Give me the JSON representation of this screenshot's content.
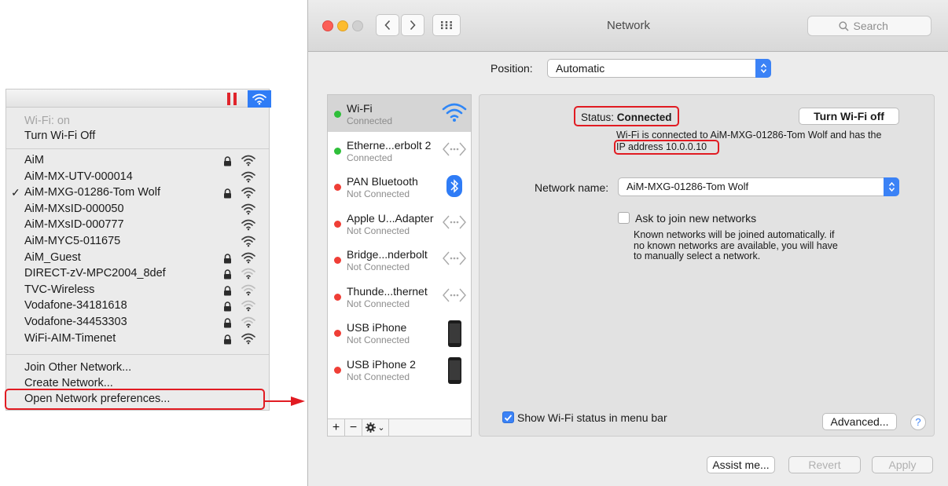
{
  "wifi_menu": {
    "status": "Wi-Fi: on",
    "toggle_label": "Turn Wi-Fi Off",
    "networks": [
      {
        "name": "AiM",
        "checked": false,
        "locked": true,
        "strength": "full"
      },
      {
        "name": "AiM-MX-UTV-000014",
        "checked": false,
        "locked": false,
        "strength": "full"
      },
      {
        "name": "AiM-MXG-01286-Tom Wolf",
        "checked": true,
        "locked": true,
        "strength": "full"
      },
      {
        "name": "AiM-MXsID-000050",
        "checked": false,
        "locked": false,
        "strength": "full"
      },
      {
        "name": "AiM-MXsID-000777",
        "checked": false,
        "locked": false,
        "strength": "full"
      },
      {
        "name": "AiM-MYC5-011675",
        "checked": false,
        "locked": false,
        "strength": "full"
      },
      {
        "name": "AiM_Guest",
        "checked": false,
        "locked": true,
        "strength": "full"
      },
      {
        "name": "DIRECT-zV-MPC2004_8def",
        "checked": false,
        "locked": true,
        "strength": "weak"
      },
      {
        "name": "TVC-Wireless",
        "checked": false,
        "locked": true,
        "strength": "weak"
      },
      {
        "name": "Vodafone-34181618",
        "checked": false,
        "locked": true,
        "strength": "weak"
      },
      {
        "name": "Vodafone-34453303",
        "checked": false,
        "locked": true,
        "strength": "weak"
      },
      {
        "name": "WiFi-AIM-Timenet",
        "checked": false,
        "locked": true,
        "strength": "full"
      }
    ],
    "check_mark": "✓",
    "join_other": "Join Other Network...",
    "create_network": "Create Network...",
    "open_prefs": "Open Network preferences..."
  },
  "window": {
    "title": "Network",
    "search_placeholder": "Search",
    "position_label": "Position:",
    "position_value": "Automatic"
  },
  "services": [
    {
      "name": "Wi-Fi",
      "status": "Connected",
      "dot": "green",
      "icon": "wifi-icon",
      "selected": true
    },
    {
      "name": "Etherne...erbolt 2",
      "status": "Connected",
      "dot": "green",
      "icon": "ethernet-icon",
      "selected": false
    },
    {
      "name": "PAN Bluetooth",
      "status": "Not Connected",
      "dot": "red",
      "icon": "bluetooth-icon",
      "selected": false
    },
    {
      "name": "Apple U...Adapter",
      "status": "Not Connected",
      "dot": "red",
      "icon": "ethernet-icon",
      "selected": false
    },
    {
      "name": "Bridge...nderbolt",
      "status": "Not Connected",
      "dot": "red",
      "icon": "ethernet-icon",
      "selected": false
    },
    {
      "name": "Thunde...thernet",
      "status": "Not Connected",
      "dot": "red",
      "icon": "ethernet-icon",
      "selected": false
    },
    {
      "name": "USB iPhone",
      "status": "Not Connected",
      "dot": "red",
      "icon": "iphone-icon",
      "selected": false
    },
    {
      "name": "USB iPhone 2",
      "status": "Not Connected",
      "dot": "red",
      "icon": "iphone-icon",
      "selected": false
    }
  ],
  "sidebar_tools": {
    "add": "+",
    "remove": "−",
    "gear_arrow": "⌄"
  },
  "detail": {
    "status_prefix": "Status:",
    "status_value": "Connected",
    "turn_off_label": "Turn Wi-Fi off",
    "connected_text": "Wi-Fi is connected to AiM-MXG-01286-Tom Wolf and has the",
    "ip_text": "IP address 10.0.0.10",
    "network_name_label": "Network name:",
    "network_name_value": "AiM-MXG-01286-Tom Wolf",
    "ask_join_label": "Ask to join new networks",
    "ask_join_desc": [
      "Known networks will be joined automatically. if",
      "no known networks are available, you will have",
      "to manually select a network."
    ],
    "show_status_label": "Show Wi-Fi status in menu bar",
    "advanced_label": "Advanced...",
    "help_label": "?"
  },
  "footer": {
    "assist": "Assist me...",
    "revert": "Revert",
    "apply": "Apply"
  },
  "colors": {
    "accent": "#3b82f6",
    "highlight": "#e11b22",
    "connected": "#2fbf3a",
    "disconnected": "#ef3e36"
  }
}
